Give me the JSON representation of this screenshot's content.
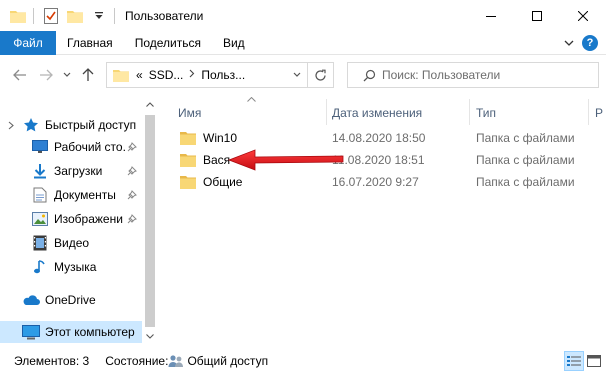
{
  "window": {
    "title": "Пользователи"
  },
  "ribbon": {
    "tabs": [
      "Файл",
      "Главная",
      "Поделиться",
      "Вид"
    ],
    "help_label": "?"
  },
  "address": {
    "overflow": "«",
    "segments": [
      "SSD...",
      "Польз..."
    ]
  },
  "search": {
    "placeholder": "Поиск: Пользователи"
  },
  "nav_pane": {
    "items": [
      {
        "label": "Быстрый доступ",
        "icon": "star-icon",
        "pinned": false
      },
      {
        "label": "Рабочий сто.",
        "icon": "desktop-icon",
        "pinned": true
      },
      {
        "label": "Загрузки",
        "icon": "download-icon",
        "pinned": true
      },
      {
        "label": "Документы",
        "icon": "documents-icon",
        "pinned": true
      },
      {
        "label": "Изображени",
        "icon": "pictures-icon",
        "pinned": true
      },
      {
        "label": "Видео",
        "icon": "video-icon",
        "pinned": false
      },
      {
        "label": "Музыка",
        "icon": "music-icon",
        "pinned": false
      },
      {
        "label": "OneDrive",
        "icon": "cloud-icon",
        "pinned": false
      },
      {
        "label": "Этот компьютер",
        "icon": "computer-icon",
        "pinned": false,
        "selected": true
      }
    ]
  },
  "file_list": {
    "columns": [
      "Имя",
      "Дата изменения",
      "Тип",
      "Р"
    ],
    "rows": [
      {
        "name": "Win10",
        "date": "14.08.2020 18:50",
        "type": "Папка с файлами"
      },
      {
        "name": "Вася",
        "date": "11.08.2020 18:51",
        "type": "Папка с файлами"
      },
      {
        "name": "Общие",
        "date": "16.07.2020 9:27",
        "type": "Папка с файлами"
      }
    ]
  },
  "status": {
    "items_count": "Элементов: 3",
    "state_label": "Состояние:",
    "state_value": "Общий доступ"
  },
  "colors": {
    "accent": "#1979ca",
    "folder": "#f8d775",
    "arrow": "#e8141c",
    "selected": "#cce8ff"
  }
}
